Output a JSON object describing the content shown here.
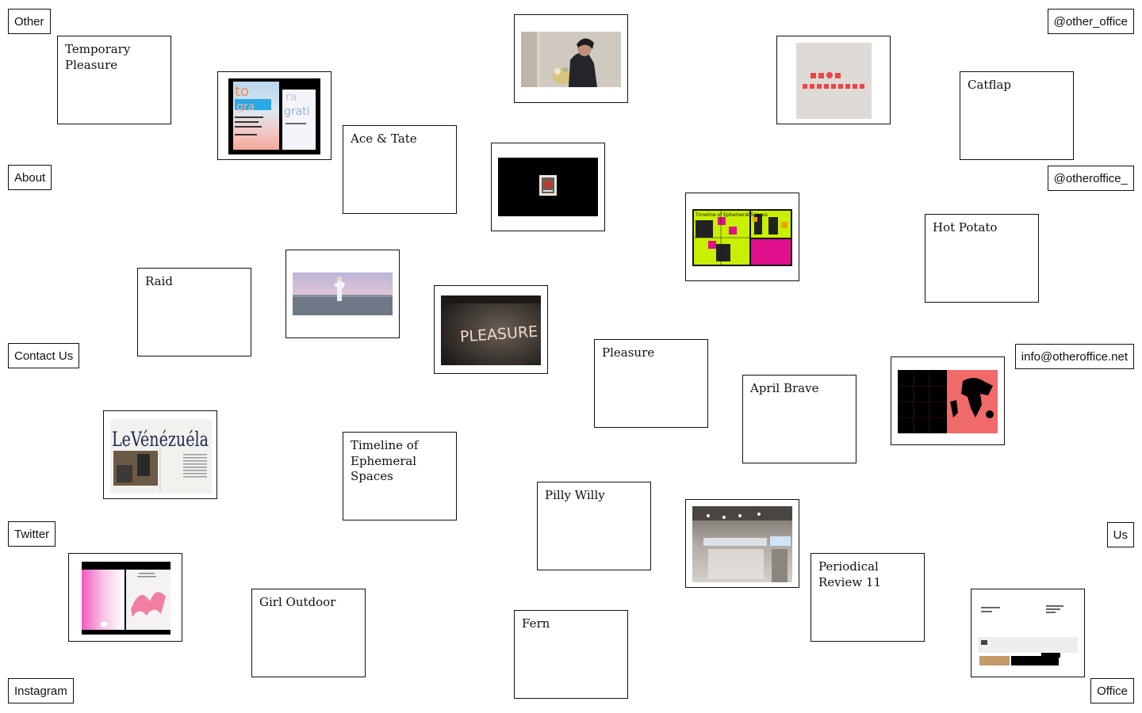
{
  "nav": {
    "other": "Other",
    "about": "About",
    "contact": "Contact Us",
    "twitter": "Twitter",
    "instagram": "Instagram",
    "handle_top": "@other_office",
    "handle_mid": "@otheroffice_",
    "email": "info@otheroffice.net",
    "us": "Us",
    "office": "Office"
  },
  "projects": {
    "temporary_pleasure": "Temporary Pleasure",
    "ace_tate": "Ace & Tate",
    "catflap": "Catflap",
    "hot_potato": "Hot Potato",
    "raid": "Raid",
    "pleasure": "Pleasure",
    "april_brave": "April Brave",
    "timeline": "Timeline of Ephemeral Spaces",
    "pilly_willy": "Pilly Willy",
    "periodical_review": "Periodical Review 11",
    "girl_outdoor": "Girl Outdoor",
    "fern": "Fern"
  },
  "thumb_text": {
    "neon_sign": "PLEASURE",
    "magazine_title": "LeVénézuéla",
    "poster_title": "Timeline of Ephemeral Spaces"
  },
  "colors": {
    "border": "#111111",
    "background": "#ffffff",
    "accent_red": "#ee4444",
    "accent_pink": "#f06a6a",
    "accent_lime": "#c8f000",
    "accent_magenta": "#e0108c"
  }
}
